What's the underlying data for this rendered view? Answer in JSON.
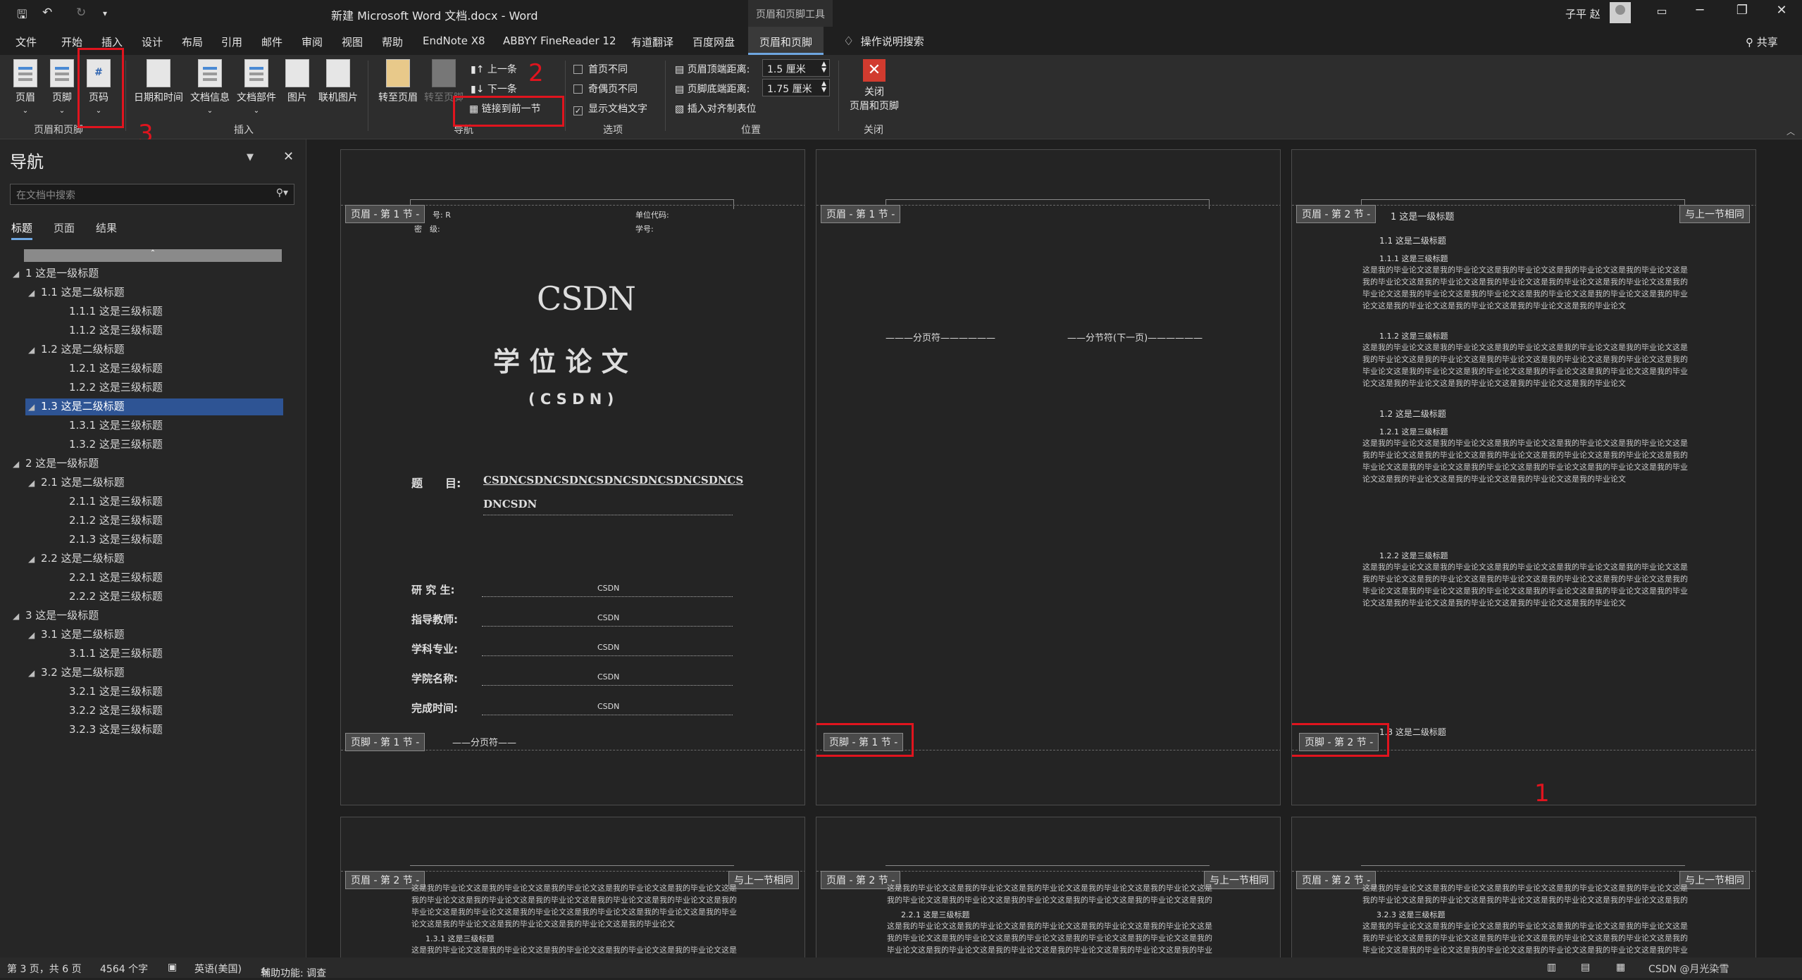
{
  "titlebar": {
    "title": "新建 Microsoft Word 文档.docx - Word",
    "context_tab": "页眉和页脚工具",
    "user": "子平 赵",
    "qat": {
      "save": "🖫",
      "undo": "↶",
      "redo": "↻",
      "more": "▾"
    },
    "window": {
      "ribbon_opts": "▭",
      "min": "─",
      "restore": "❐",
      "close": "✕"
    }
  },
  "menu": {
    "tabs": [
      "文件",
      "开始",
      "插入",
      "设计",
      "布局",
      "引用",
      "邮件",
      "审阅",
      "视图",
      "帮助",
      "EndNote X8",
      "ABBYY FineReader 12",
      "有道翻译",
      "百度网盘",
      "页眉和页脚"
    ],
    "tell": "操作说明搜索",
    "share": "共享"
  },
  "ribbon": {
    "header": "页眉",
    "footer": "页脚",
    "page_number": "页码",
    "group_hf": "页眉和页脚",
    "datetime": "日期和时间",
    "docinfo": "文档信息",
    "quickparts": "文档部件",
    "picture": "图片",
    "online_picture": "联机图片",
    "group_insert": "插入",
    "goto_header": "转至页眉",
    "goto_footer": "转至页脚",
    "prev": "上一条",
    "next": "下一条",
    "link_prev": "链接到前一节",
    "group_nav": "导航",
    "diff_first": "首页不同",
    "diff_oddeven": "奇偶页不同",
    "show_text": "显示文档文字",
    "group_options": "选项",
    "header_top_label": "页眉顶端距离:",
    "header_top_value": "1.5 厘米",
    "footer_bottom_label": "页脚底端距离:",
    "footer_bottom_value": "1.75 厘米",
    "align_tab": "插入对齐制表位",
    "group_position": "位置",
    "close": "关闭",
    "close2": "页眉和页脚",
    "group_close": "关闭"
  },
  "annotations": {
    "n1": "1",
    "n2": "2",
    "n3": "3"
  },
  "nav": {
    "title": "导航",
    "search_placeholder": "在文档中搜索",
    "tabs": [
      "标题",
      "页面",
      "结果"
    ],
    "items": [
      {
        "level": 1,
        "text": "1 这是一级标题",
        "tri": "◢"
      },
      {
        "level": 2,
        "text": "1.1 这是二级标题",
        "tri": "◢"
      },
      {
        "level": 3,
        "text": "1.1.1 这是三级标题",
        "tri": ""
      },
      {
        "level": 3,
        "text": "1.1.2 这是三级标题",
        "tri": ""
      },
      {
        "level": 2,
        "text": "1.2 这是二级标题",
        "tri": "◢"
      },
      {
        "level": 3,
        "text": "1.2.1 这是三级标题",
        "tri": ""
      },
      {
        "level": 3,
        "text": "1.2.2 这是三级标题",
        "tri": ""
      },
      {
        "level": 2,
        "text": "1.3 这是二级标题",
        "tri": "◢",
        "selected": true
      },
      {
        "level": 3,
        "text": "1.3.1 这是三级标题",
        "tri": ""
      },
      {
        "level": 3,
        "text": "1.3.2 这是三级标题",
        "tri": ""
      },
      {
        "level": 1,
        "text": "2 这是一级标题",
        "tri": "◢"
      },
      {
        "level": 2,
        "text": "2.1 这是二级标题",
        "tri": "◢"
      },
      {
        "level": 3,
        "text": "2.1.1 这是三级标题",
        "tri": ""
      },
      {
        "level": 3,
        "text": "2.1.2 这是三级标题",
        "tri": ""
      },
      {
        "level": 3,
        "text": "2.1.3 这是三级标题",
        "tri": ""
      },
      {
        "level": 2,
        "text": "2.2 这是二级标题",
        "tri": "◢"
      },
      {
        "level": 3,
        "text": "2.2.1 这是三级标题",
        "tri": ""
      },
      {
        "level": 3,
        "text": "2.2.2 这是三级标题",
        "tri": ""
      },
      {
        "level": 1,
        "text": "3 这是一级标题",
        "tri": "◢"
      },
      {
        "level": 2,
        "text": "3.1 这是二级标题",
        "tri": "◢"
      },
      {
        "level": 3,
        "text": "3.1.1 这是三级标题",
        "tri": ""
      },
      {
        "level": 2,
        "text": "3.2 这是二级标题",
        "tri": "◢"
      },
      {
        "level": 3,
        "text": "3.2.1 这是三级标题",
        "tri": ""
      },
      {
        "level": 3,
        "text": "3.2.2 这是三级标题",
        "tri": ""
      },
      {
        "level": 3,
        "text": "3.2.3 这是三级标题",
        "tri": ""
      }
    ]
  },
  "pages": {
    "h_s1": "页眉 - 第 1 节 -",
    "f_s1": "页脚 - 第 1 节 -",
    "h_s2": "页眉 - 第 2 节 -",
    "f_s2": "页脚 - 第 2 节 -",
    "same": "与上一节相同",
    "cover": {
      "cls_no": "号: R",
      "secret": "密　级:",
      "unit_code": "单位代码:",
      "student_no": "学号:",
      "csdn": "CSDN",
      "thesis": "学 位 论 文",
      "sub": "( C S D N )",
      "title_label": "题　　目:",
      "title_value1": "CSDNCSDNCSDNCSDNCSDNCSDNCSDNCS",
      "title_value2": "DNCSDN",
      "fields": [
        {
          "label": "研 究 生:",
          "value": "CSDN"
        },
        {
          "label": "指导教师:",
          "value": "CSDN"
        },
        {
          "label": "学科专业:",
          "value": "CSDN"
        },
        {
          "label": "学院名称:",
          "value": "CSDN"
        },
        {
          "label": "完成时间:",
          "value": "CSDN"
        }
      ],
      "page_break": "分页符"
    },
    "p2": {
      "page_break": "分页符",
      "section_break": "分节符(下一页)"
    },
    "p3": {
      "h1": "1 这是一级标题",
      "h11": "1.1 这是二级标题",
      "h111": "1.1.1 这是三级标题",
      "h112": "1.1.2 这是三级标题",
      "h12": "1.2 这是二级标题",
      "h121": "1.2.1 这是三级标题",
      "h122": "1.2.2 这是三级标题",
      "h13": "1.3 这是二级标题",
      "body": "这是我的毕业论文这是我的毕业论文这是我的毕业论文这是我的毕业论文这是我的毕业论文这是我的毕业论文这是我的毕业论文这是我的毕业论文这是我的毕业论文这是我的毕业论文这是我的毕业论文这是我的毕业论文这是我的毕业论文这是我的毕业论文这是我的毕业论文这是我的毕业论文这是我的毕业论文这是我的毕业论文这是我的毕业论文这是我的毕业论文"
    },
    "p4": {
      "h131": "1.3.1 这是三级标题"
    },
    "p5": {
      "h221": "2.2.1 这是三级标题"
    },
    "p6": {
      "h323": "3.2.3 这是三级标题"
    }
  },
  "status": {
    "page": "第 3 页，共 6 页",
    "words": "4564 个字",
    "lang": "英语(美国)",
    "access": "辅助功能: 调查",
    "watermark": "CSDN @月光染雪"
  }
}
